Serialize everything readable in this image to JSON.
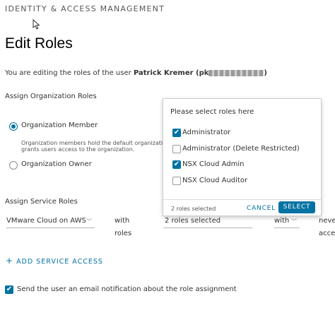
{
  "header": {
    "section_title": "IDENTITY & ACCESS MANAGEMENT",
    "page_title": "Edit Roles"
  },
  "editing": {
    "prefix": "You are editing the roles of the user ",
    "user_name": "Patrick Kremer",
    "email_open": " (pk",
    "email_close": ")"
  },
  "org_roles": {
    "title": "Assign Organization Roles",
    "member_label": "Organization Member",
    "member_help_line1": "Organization members hold the default organization ro",
    "member_help_line2": "grants users access to the organization.",
    "owner_label": "Organization Owner",
    "selected": "Organization Member"
  },
  "service_roles": {
    "title": "Assign Service Roles",
    "service_value": "VMware Cloud on AWS",
    "with_roles_line1": "with",
    "with_roles_line2": "roles",
    "roles_value": "2 roles selected",
    "with_value": "with",
    "never_line1": "neve",
    "never_line2": "acce"
  },
  "add_service": {
    "label": "ADD SERVICE ACCESS",
    "plus": "+"
  },
  "notify": {
    "label": "Send the user an email notification about the role assignment",
    "checked": true
  },
  "roles_popup": {
    "header": "Please select roles here",
    "options": [
      {
        "label": "Administrator",
        "checked": true
      },
      {
        "label": "Administrator (Delete Restricted)",
        "checked": false
      },
      {
        "label": "NSX Cloud Admin",
        "checked": true
      },
      {
        "label": "NSX Cloud Auditor",
        "checked": false
      }
    ],
    "count_text": "2 roles selected",
    "cancel_label": "CANCEL",
    "select_label": "SELECT"
  },
  "icons": {
    "check": "✔",
    "caret": "﹀"
  },
  "colors": {
    "accent": "#0072a3"
  }
}
